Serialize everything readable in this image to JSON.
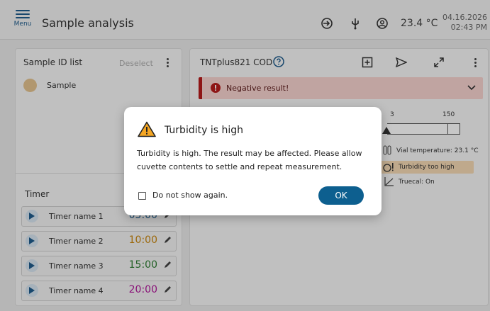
{
  "header": {
    "menu_label": "Menu",
    "title": "Sample analysis",
    "temperature": "23.4 °C",
    "date": "04.16.2026",
    "time": "02:43 PM"
  },
  "sample_panel": {
    "title": "Sample ID list",
    "deselect_label": "Deselect",
    "samples": [
      {
        "label": "Sample",
        "color": "#e3c28f"
      }
    ]
  },
  "timer_panel": {
    "title": "Timer",
    "timers": [
      {
        "name": "Timer name 1",
        "value": "05:00",
        "color": "#1f5c8c"
      },
      {
        "name": "Timer name 2",
        "value": "10:00",
        "color": "#c8860f"
      },
      {
        "name": "Timer name 3",
        "value": "15:00",
        "color": "#2e7d32"
      },
      {
        "name": "Timer name 4",
        "value": "20:00",
        "color": "#b0179a"
      }
    ]
  },
  "result_panel": {
    "test_name": "TNTplus821 COD",
    "banner_text": "Negative result!",
    "scale_low": "3",
    "scale_high": "150",
    "vial_temperature": "Vial temperature: 23.1 °C",
    "turbidity_status": "Turbidity too high",
    "truecal": "Truecal: On"
  },
  "dialog": {
    "title": "Turbidity is high",
    "message": "Turbidity is high. The result may be affected. Please allow cuvette contents to settle and repeat measurement.",
    "checkbox_label": "Do not show again.",
    "ok_label": "OK"
  },
  "colors": {
    "accent": "#0d5f8f",
    "error": "#b71c1c",
    "warning": "#f5a623"
  }
}
